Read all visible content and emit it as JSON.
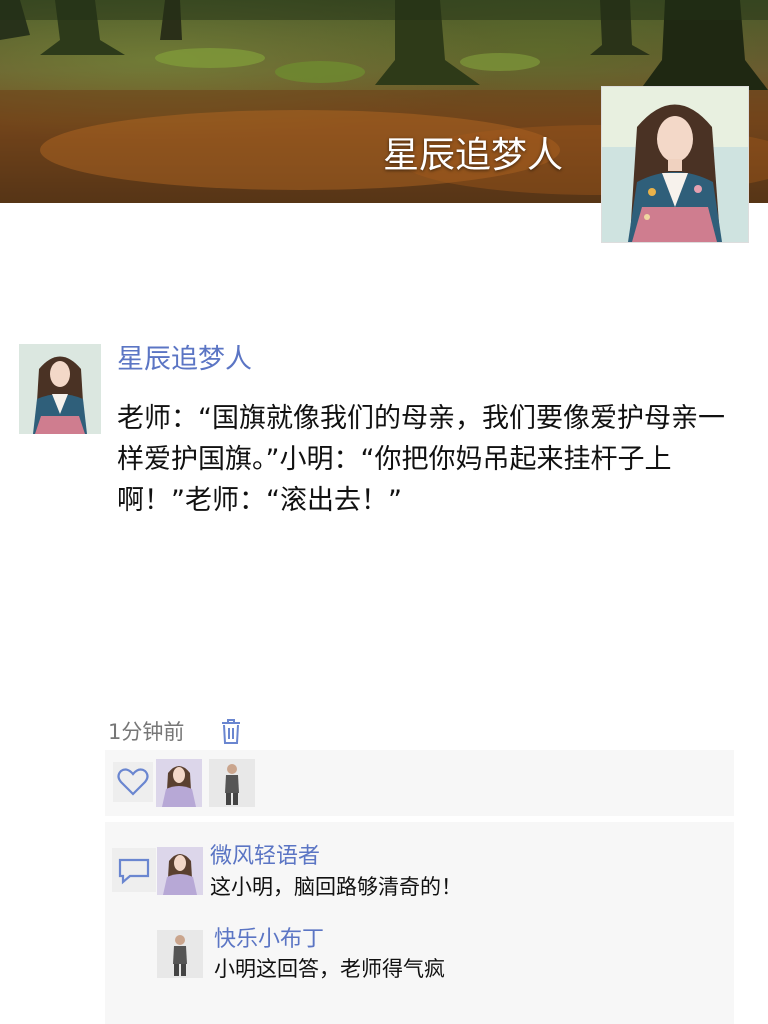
{
  "profile": {
    "name": "星辰追梦人"
  },
  "post": {
    "author": "星辰追梦人",
    "text": "老师：“国旗就像我们的母亲，我们要像爱护母亲一样爱护国旗。”小明：“你把你妈吊起来挂杆子上啊！”老师：“滚出去！”",
    "time": "1分钟前"
  },
  "likes": {
    "icon": "heart-icon",
    "avatars": [
      "hanbok-girl-avatar",
      "suit-man-avatar"
    ]
  },
  "comments": [
    {
      "author": "微风轻语者",
      "text": "这小明，脑回路够清奇的！"
    },
    {
      "author": "快乐小布丁",
      "text": "小明这回答，老师得气疯"
    }
  ],
  "colors": {
    "link": "#5b75c4",
    "panel": "#f7f7f7",
    "icon": "#6a86d0"
  }
}
